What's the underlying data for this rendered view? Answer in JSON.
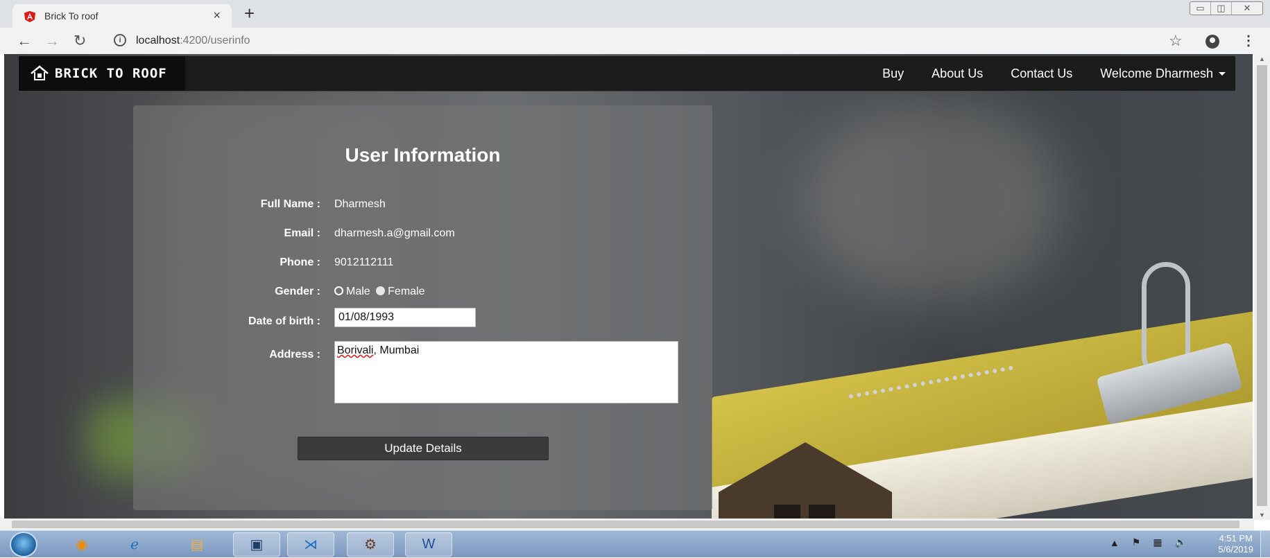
{
  "browser": {
    "tab_title": "Brick To roof",
    "tab_close": "×",
    "new_tab": "+",
    "url_host": "localhost",
    "url_path": ":4200/userinfo",
    "win_minimize": "▭",
    "win_maximize": "◫",
    "win_close": "✕"
  },
  "navbar": {
    "brand": "BRICK TO ROOF",
    "links": [
      "Buy",
      "About Us",
      "Contact Us"
    ],
    "welcome": "Welcome Dharmesh"
  },
  "user_info": {
    "title": "User Information",
    "labels": {
      "full_name": "Full Name :",
      "email": "Email :",
      "phone": "Phone :",
      "gender": "Gender :",
      "dob": "Date of birth :",
      "address": "Address :"
    },
    "values": {
      "full_name": "Dharmesh",
      "email": "dharmesh.a@gmail.com",
      "phone": "9012112111",
      "gender_male": "Male",
      "gender_female": "Female",
      "dob": "01/08/1993",
      "address_word1": "Borivali",
      "address_rest": ", Mumbai"
    },
    "update_button": "Update Details"
  },
  "taskbar": {
    "time": "4:51 PM",
    "date": "5/6/2019"
  }
}
